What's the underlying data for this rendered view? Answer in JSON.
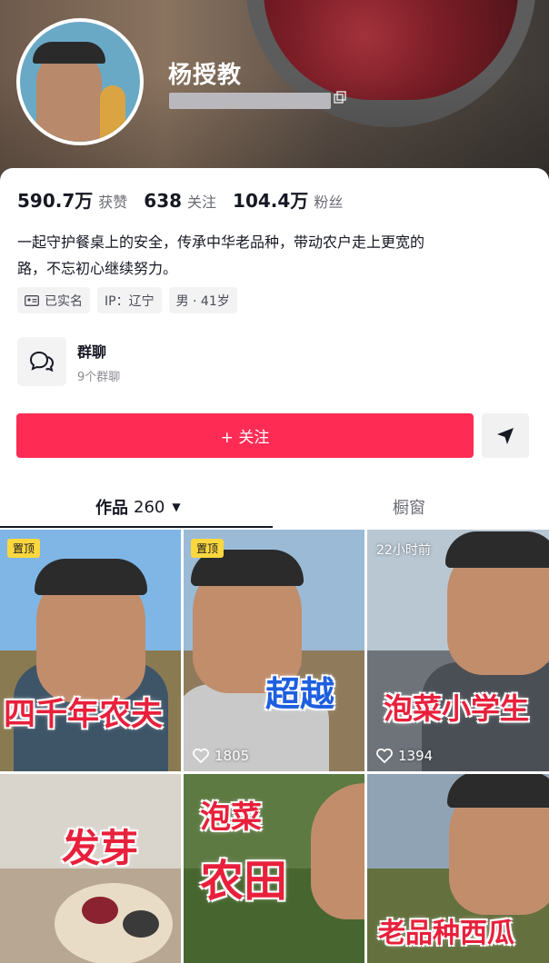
{
  "profile": {
    "username": "杨授教",
    "stats": [
      {
        "value": "590.7万",
        "label": "获赞"
      },
      {
        "value": "638",
        "label": "关注"
      },
      {
        "value": "104.4万",
        "label": "粉丝"
      }
    ],
    "bio_line1": "一起守护餐桌上的安全，传承中华老品种，带动农户走上更宽的",
    "bio_line2": "路，不忘初心继续努力。",
    "tags": {
      "verified": "已实名",
      "ip": "IP：辽宁",
      "gender_age": "男 · 41岁"
    }
  },
  "group_chat": {
    "title": "群聊",
    "subtitle": "9个群聊"
  },
  "actions": {
    "follow_label": "+ 关注"
  },
  "tabs": {
    "works_label": "作品",
    "works_count": "260",
    "works_arrow": "▼",
    "window_label": "橱窗"
  },
  "videos": [
    {
      "badge": "置顶",
      "title": "四千年农夫",
      "likes": ""
    },
    {
      "badge": "置顶",
      "title": "超越",
      "likes": "1805"
    },
    {
      "time": "22小时前",
      "title": "泡菜小学生",
      "likes": "1394"
    },
    {
      "title": "发芽"
    },
    {
      "title_line1": "泡菜",
      "title_line2": "农田"
    },
    {
      "title": "老品种西瓜"
    }
  ],
  "colors": {
    "accent": "#fe2c55",
    "pin_badge": "#fcd73e",
    "overlay_red": "#e8203b",
    "overlay_blue": "#1e5fe0"
  }
}
